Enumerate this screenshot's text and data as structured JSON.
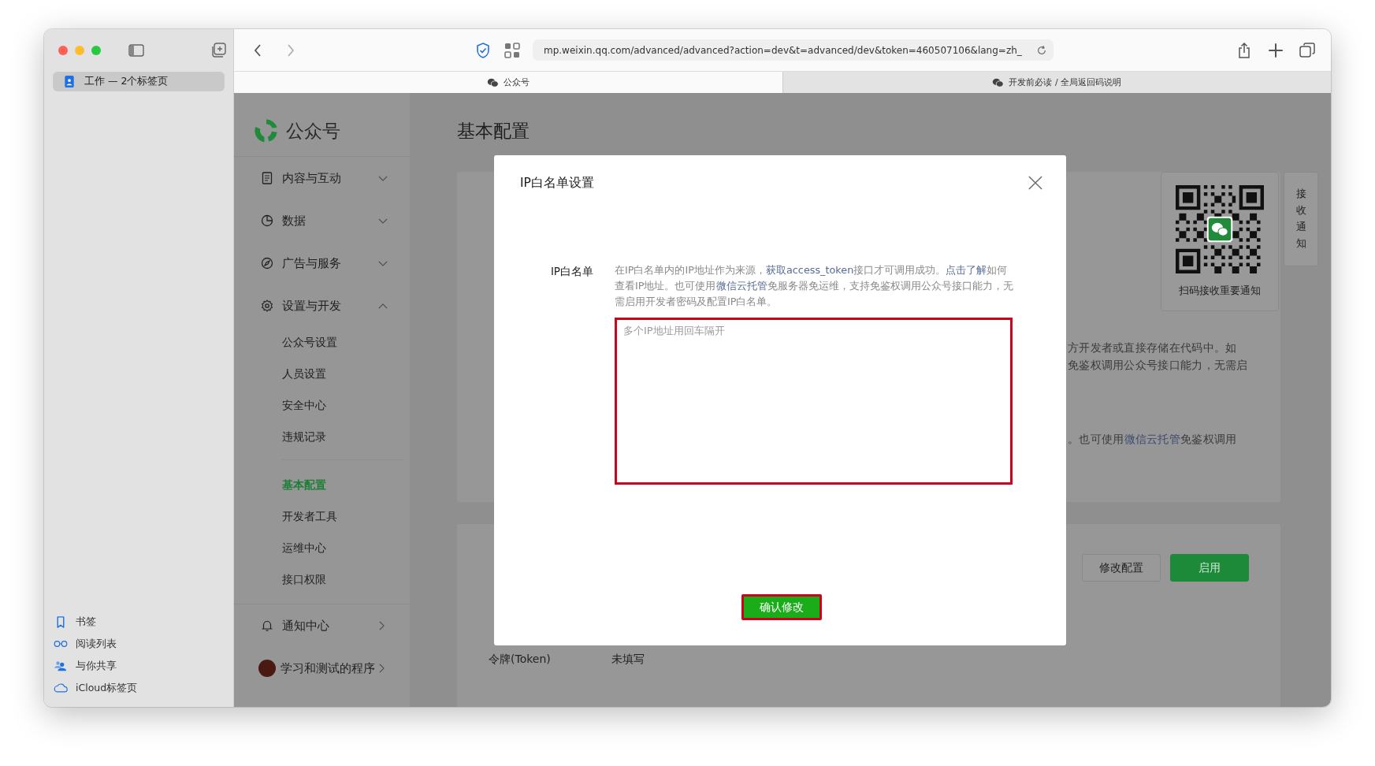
{
  "browser": {
    "sidebar": {
      "tab_group": {
        "label": "工作 — 2个标签页",
        "selected": true
      },
      "items": [
        {
          "label": "书签"
        },
        {
          "label": "阅读列表"
        },
        {
          "label": "与你共享"
        },
        {
          "label": "iCloud标签页"
        }
      ]
    },
    "url": "mp.weixin.qq.com/advanced/advanced?action=dev&t=advanced/dev&token=460507106&lang=zh_",
    "tabs": [
      {
        "label": "公众号",
        "selected": true
      },
      {
        "label": "开发前必读 / 全局返回码说明",
        "selected": false
      }
    ]
  },
  "nav": {
    "logo": "公众号",
    "items": [
      {
        "label": "内容与互动",
        "kind": "group",
        "expanded": false
      },
      {
        "label": "数据",
        "kind": "group",
        "expanded": false
      },
      {
        "label": "广告与服务",
        "kind": "group",
        "expanded": false
      },
      {
        "label": "设置与开发",
        "kind": "group",
        "expanded": true,
        "children": [
          {
            "children": [
              {
                "label": "公众号设置",
                "selected": false
              },
              {
                "label": "人员设置",
                "selected": false
              },
              {
                "label": "安全中心",
                "selected": false
              },
              {
                "label": "违规记录",
                "selected": false
              }
            ]
          },
          {
            "children": [
              {
                "label": "基本配置",
                "selected": true
              },
              {
                "label": "开发者工具",
                "selected": false
              },
              {
                "label": "运维中心",
                "selected": false
              },
              {
                "label": "接口权限",
                "selected": false
              }
            ]
          }
        ]
      }
    ],
    "links": [
      {
        "label": "通知中心"
      },
      {
        "label": "学习和测试的程序"
      }
    ]
  },
  "page": {
    "title": "基本配置",
    "paragraphs": [
      {
        "lines": [
          [
            {
              "text": "方开发者或直接存储在代码中。如",
              "link": false
            }
          ],
          [
            {
              "text": "免鉴权调用公众号接口能力，无需启",
              "link": false
            }
          ]
        ]
      },
      {
        "lines": [
          [
            {
              "text": "。也可使用",
              "link": false
            },
            {
              "text": "微信云托管",
              "link": true
            },
            {
              "text": "免鉴权调用",
              "link": false
            }
          ]
        ]
      }
    ],
    "qr_caption": "扫码接收重要通知",
    "side_tab": "接收通知",
    "actions": [
      {
        "label": "修改配置",
        "primary": false
      },
      {
        "label": "启用",
        "primary": true
      }
    ],
    "fields": [
      {
        "label": "令牌(Token)",
        "value": "未填写"
      }
    ]
  },
  "dialog": {
    "title": "IP白名单设置",
    "field_label": "IP白名单",
    "description": [
      {
        "text": "在IP白名单内的IP地址作为来源，",
        "link": false
      },
      {
        "text": "获取access_token",
        "link": true
      },
      {
        "text": "接口才可调用成功。",
        "link": false
      },
      {
        "text": "点击了解",
        "link": true
      },
      {
        "text": "如何查看IP地址。也可使用",
        "link": false
      },
      {
        "text": "微信云托管",
        "link": true
      },
      {
        "text": "免服务器免运维，支持免鉴权调用公众号接口能力，无需启用开发者密码及配置IP白名单。",
        "link": false
      }
    ],
    "placeholder": "多个IP地址用回车隔开",
    "confirm": "确认修改"
  }
}
